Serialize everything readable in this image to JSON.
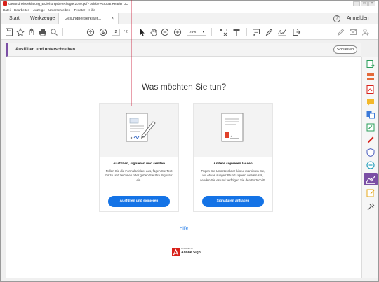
{
  "window": {
    "title": "Gesundheitserklärung_Erziehungsberechtigte 2020.pdf - Adobe Acrobat Reader DC",
    "controls": [
      "–",
      "□",
      "×"
    ]
  },
  "menu": [
    "Datei",
    "Bearbeiten",
    "Anzeige",
    "Unterschreiben",
    "Fenster",
    "Hilfe"
  ],
  "tabs": {
    "start": "Start",
    "tools": "Werkzeuge",
    "document": "Gesundheitserklaer...",
    "document_close": "×",
    "help": "?",
    "login": "Anmelden"
  },
  "toolbar": {
    "page_current": "2",
    "page_separator": "/ 2",
    "zoom": "75%"
  },
  "tool_panel": {
    "label": "Ausfüllen und unterschreiben",
    "close": "Schließen"
  },
  "main": {
    "heading": "Was möchten Sie tun?",
    "cards": [
      {
        "title": "Ausfüllen, signieren und senden",
        "description": "Füllen Sie die Formularfelder aus, fügen Sie Text hinzu und zeichnen oder geben Sie Ihre Signatur ein.",
        "button": "Ausfüllen und signieren"
      },
      {
        "title": "Andere signieren lassen",
        "description": "Fügen Sie Unterzeichner hinzu, markieren Sie, wo etwas ausgefüllt und signiert werden soll, senden Sie es und verfolgen Sie den Fortschritt.",
        "button": "Signaturen anfragen"
      }
    ],
    "help_link": "Hilfe",
    "powered_by": "POWERED BY",
    "adobe_sign": "Adobe Sign"
  },
  "colors": {
    "accent_blue": "#1473e6",
    "tool_purple": "#7b4fa5",
    "adobe_red": "#d8211a",
    "annotation_line": "#c8102e"
  }
}
